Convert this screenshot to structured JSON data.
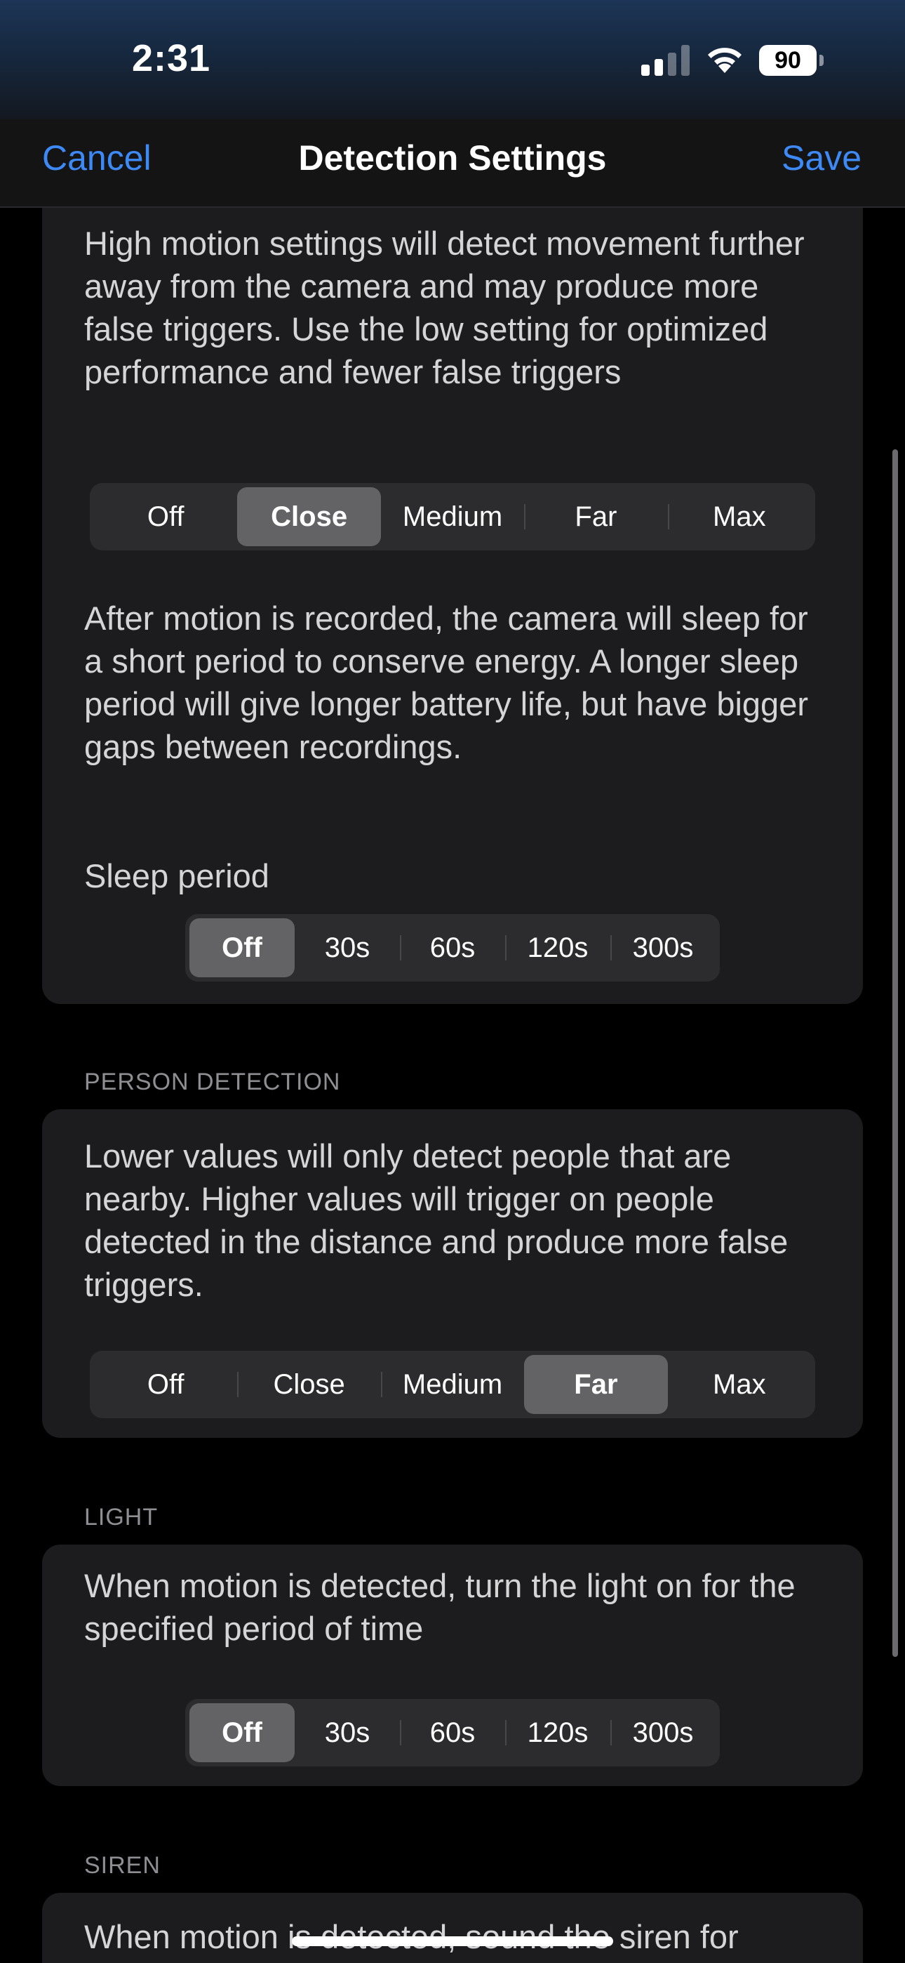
{
  "status_bar": {
    "time": "2:31",
    "battery_level": "90",
    "signal_bars_active": 2,
    "signal_bars_total": 4
  },
  "nav": {
    "cancel_label": "Cancel",
    "title": "Detection Settings",
    "save_label": "Save"
  },
  "motion": {
    "description": "High motion settings will detect movement further away from the camera and may produce more false triggers. Use the low setting for optimized performance and fewer false triggers",
    "sensitivity_options": [
      "Off",
      "Close",
      "Medium",
      "Far",
      "Max"
    ],
    "sensitivity_selected": "Close",
    "sleep_description": "After motion is recorded, the camera will sleep for a short period to conserve energy. A longer sleep period will give longer battery life, but have bigger gaps between recordings.",
    "sleep_label": "Sleep period",
    "sleep_options": [
      "Off",
      "30s",
      "60s",
      "120s",
      "300s"
    ],
    "sleep_selected": "Off"
  },
  "person_detection": {
    "header": "PERSON DETECTION",
    "description": "Lower values will only detect people that are nearby. Higher values will trigger on people detected in the distance and produce more false triggers.",
    "options": [
      "Off",
      "Close",
      "Medium",
      "Far",
      "Max"
    ],
    "selected": "Far"
  },
  "light": {
    "header": "LIGHT",
    "description": "When motion is detected, turn the light on for the specified period of time",
    "options": [
      "Off",
      "30s",
      "60s",
      "120s",
      "300s"
    ],
    "selected": "Off"
  },
  "siren": {
    "header": "SIREN",
    "description": "When motion is detected, sound the siren for"
  },
  "colors": {
    "accent": "#3d8af7",
    "card_background": "#1c1c1e",
    "segment_selected": "#636366"
  }
}
